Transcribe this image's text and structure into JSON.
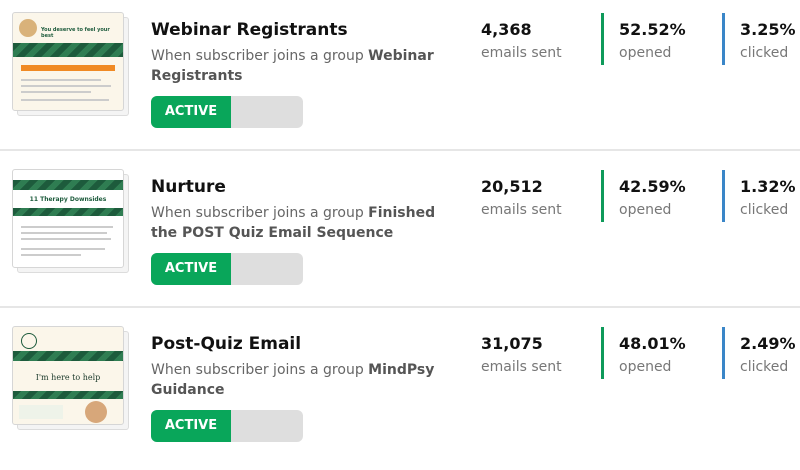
{
  "automations": [
    {
      "title": "Webinar Registrants",
      "desc_prefix": "When subscriber joins a group",
      "desc_group": "Webinar Registrants",
      "status": "ACTIVE",
      "emails_sent": "4,368",
      "emails_sent_label": "emails sent",
      "opened": "52.52%",
      "opened_label": "opened",
      "clicked": "3.25%",
      "clicked_label": "clicked",
      "thumb_headline": "You deserve to feel your best"
    },
    {
      "title": "Nurture",
      "desc_prefix": "When subscriber joins a group",
      "desc_group": "Finished the POST Quiz Email Sequence",
      "status": "ACTIVE",
      "emails_sent": "20,512",
      "emails_sent_label": "emails sent",
      "opened": "42.59%",
      "opened_label": "opened",
      "clicked": "1.32%",
      "clicked_label": "clicked",
      "thumb_headline": "11 Therapy Downsides"
    },
    {
      "title": "Post-Quiz Email",
      "desc_prefix": "When subscriber joins a group",
      "desc_group": "MindPsy Guidance",
      "status": "ACTIVE",
      "emails_sent": "31,075",
      "emails_sent_label": "emails sent",
      "opened": "48.01%",
      "opened_label": "opened",
      "clicked": "2.49%",
      "clicked_label": "clicked",
      "thumb_headline": "I'm here to help"
    }
  ],
  "colors": {
    "active": "#09a65a",
    "opened_bar": "#0e9a5a",
    "clicked_bar": "#3a86c8",
    "divider": "#e6e6e6"
  }
}
